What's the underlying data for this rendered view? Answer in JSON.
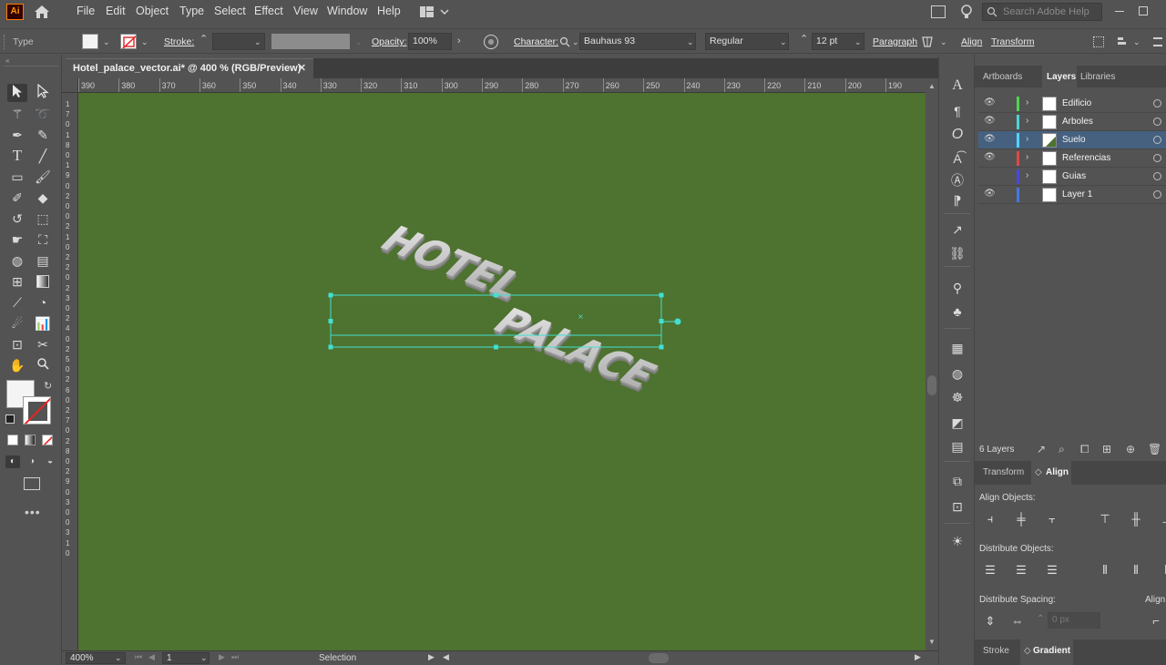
{
  "app": {
    "logo": "Ai"
  },
  "menu": [
    "File",
    "Edit",
    "Object",
    "Type",
    "Select",
    "Effect",
    "View",
    "Window",
    "Help"
  ],
  "search": {
    "placeholder": "Search Adobe Help"
  },
  "control": {
    "type_label": "Type",
    "stroke_label": "Stroke:",
    "opacity_label": "Opacity:",
    "opacity_value": "100%",
    "character_label": "Character:",
    "font_family": "Bauhaus 93",
    "font_style": "Regular",
    "font_size": "12 pt",
    "paragraph_label": "Paragraph",
    "align_label": "Align",
    "transform_label": "Transform"
  },
  "document": {
    "tab_title": "Hotel_palace_vector.ai* @ 400 % (RGB/Preview)"
  },
  "ruler": {
    "ticks": [
      "390",
      "380",
      "370",
      "360",
      "350",
      "340",
      "330",
      "320",
      "310",
      "300",
      "290",
      "280",
      "270",
      "260",
      "250",
      "240",
      "230",
      "220",
      "210",
      "200",
      "190"
    ]
  },
  "vruler": {
    "digits": [
      "1",
      "7",
      "0",
      "1",
      "8",
      "0",
      "1",
      "9",
      "0",
      "2",
      "0",
      "0",
      "2",
      "1",
      "0",
      "2",
      "2",
      "0",
      "2",
      "3",
      "0",
      "2",
      "4",
      "0",
      "2",
      "5",
      "0",
      "2",
      "6",
      "0",
      "2",
      "7",
      "0",
      "2",
      "8",
      "0",
      "2",
      "9",
      "0",
      "3",
      "0",
      "0",
      "3",
      "1",
      "0"
    ]
  },
  "artwork": {
    "line1": "HOTEL",
    "line2": "PALACE"
  },
  "panels": {
    "tabs": [
      "Artboards",
      "Layers",
      "Libraries"
    ],
    "layers": [
      {
        "name": "Edificio",
        "visible": true,
        "color": "#4fd34f"
      },
      {
        "name": "Arboles",
        "visible": true,
        "color": "#4fd3d3"
      },
      {
        "name": "Suelo",
        "visible": true,
        "color": "#4fd3ff",
        "selected": true
      },
      {
        "name": "Referencias",
        "visible": true,
        "color": "#e04848"
      },
      {
        "name": "Guias",
        "visible": false,
        "color": "#4848e0"
      },
      {
        "name": "Layer 1",
        "visible": true,
        "color": "#4878e0"
      }
    ],
    "layer_count": "6 Layers",
    "lower_tabs": [
      "Transform",
      "Align"
    ],
    "align_objects": "Align Objects:",
    "distribute_objects": "Distribute Objects:",
    "distribute_spacing": "Distribute Spacing:",
    "align_to": "Align",
    "spacing_value": "0 px",
    "bottom_tabs": [
      "Stroke",
      "Gradient"
    ]
  },
  "status": {
    "zoom": "400%",
    "artboard": "1",
    "tool": "Selection"
  }
}
